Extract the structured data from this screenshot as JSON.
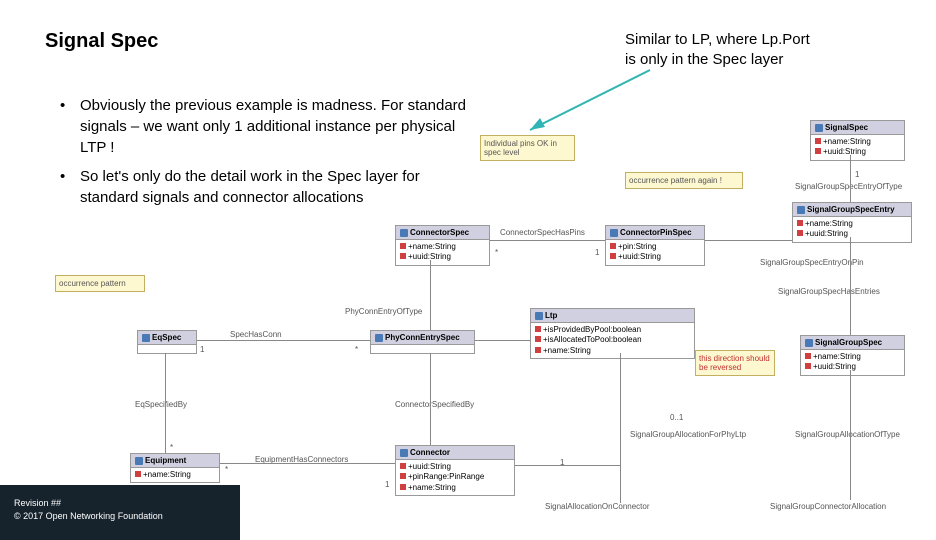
{
  "title": "Signal Spec",
  "callout": "Similar to LP, where Lp.Port is only in the Spec layer",
  "bullets": [
    "Obviously the previous example is madness. For standard signals – we want only 1 additional instance per physical LTP !",
    "So let's only do the detail work in the Spec layer for standard signals and connector allocations"
  ],
  "notes": {
    "pins": "Individual pins OK in spec level",
    "pattern_top": "occurrence pattern again !",
    "occurrence": "occurrence pattern",
    "direction": "this direction should be reversed"
  },
  "classes": {
    "connectorSpec": {
      "name": "ConnectorSpec",
      "attrs": [
        "+name:String",
        "+uuid:String"
      ]
    },
    "connectorPinSpec": {
      "name": "ConnectorPinSpec",
      "attrs": [
        "+pin:String",
        "+uuid:String"
      ]
    },
    "signalSpec": {
      "name": "SignalSpec",
      "attrs": [
        "+name:String",
        "+uuid:String"
      ]
    },
    "signalGroupSpecEntry": {
      "name": "SignalGroupSpecEntry",
      "attrs": [
        "+name:String",
        "+uuid:String"
      ]
    },
    "signalGroupSpec": {
      "name": "SignalGroupSpec",
      "attrs": [
        "+name:String",
        "+uuid:String"
      ]
    },
    "eqSpec": {
      "name": "EqSpec",
      "attrs": []
    },
    "phyConnEntrySpec": {
      "name": "PhyConnEntrySpec",
      "attrs": []
    },
    "ltp": {
      "name": "Ltp",
      "attrs": [
        "+isProvidedByPool:boolean",
        "+isAllocatedToPool:boolean",
        "+name:String"
      ]
    },
    "equipment": {
      "name": "Equipment",
      "attrs": [
        "+name:String"
      ]
    },
    "connector": {
      "name": "Connector",
      "attrs": [
        "+uuid:String",
        "+pinRange:PinRange",
        "+name:String"
      ]
    }
  },
  "labels": {
    "connectorSpecHasPins": "ConnectorSpecHasPins",
    "specEntryOfType": "SignalGroupSpecEntryOfType",
    "specEntryOnPin": "SignalGroupSpecEntryOnPin",
    "specHasEntries": "SignalGroupSpecHasEntries",
    "phyConnEntryOfType": "PhyConnEntryOfType",
    "specHasConn": "SpecHasConn",
    "eqSpecifiedBy": "EqSpecifiedBy",
    "connSpecifiedBy": "ConnectorSpecifiedBy",
    "equipmentHasConnectors": "EquipmentHasConnectors",
    "signalGroupAllocForPhyLtp": "SignalGroupAllocationForPhyLtp",
    "signalGroupAllocOfType": "SignalGroupAllocationOfType",
    "signalAllocOnConnector": "SignalAllocationOnConnector",
    "signalGroupConnAlloc": "SignalGroupConnectorAllocation"
  },
  "footer": {
    "line1": "Revision ##",
    "line2": "© 2017 Open Networking Foundation"
  }
}
